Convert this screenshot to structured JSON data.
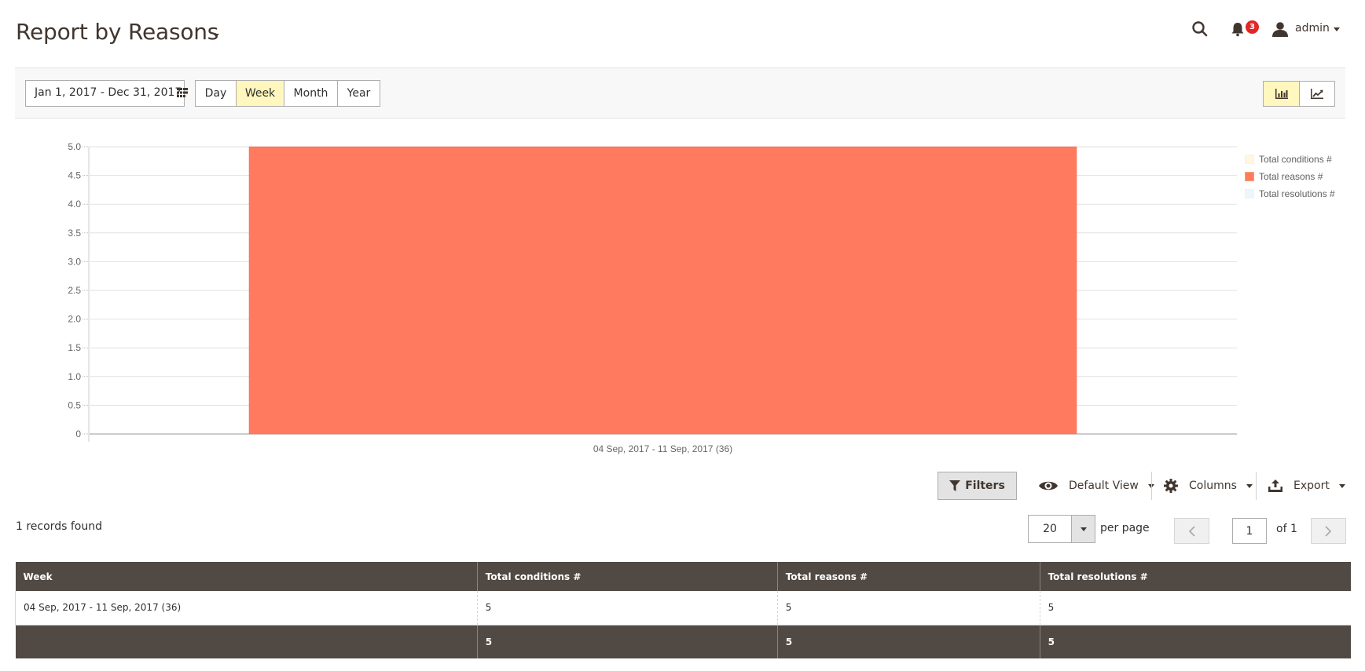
{
  "header": {
    "title": "Report by Reasons",
    "notifications_count": "3",
    "user_name": "admin"
  },
  "toolbar": {
    "date_range": "Jan 1, 2017 - Dec 31, 2017",
    "periods": [
      {
        "label": "Day",
        "active": false
      },
      {
        "label": "Week",
        "active": true
      },
      {
        "label": "Month",
        "active": false
      },
      {
        "label": "Year",
        "active": false
      }
    ],
    "chart_types": [
      {
        "name": "bar-chart",
        "active": true
      },
      {
        "name": "line-chart",
        "active": false
      }
    ]
  },
  "chart_data": {
    "type": "bar",
    "title": "",
    "xlabel": "",
    "ylabel": "",
    "categories": [
      "04 Sep, 2017 - 11 Sep, 2017 (36)"
    ],
    "series": [
      {
        "name": "Total conditions #",
        "values": [
          0
        ],
        "color": "#fff7e0"
      },
      {
        "name": "Total reasons #",
        "values": [
          5
        ],
        "color": "#ff7a5f"
      },
      {
        "name": "Total resolutions #",
        "values": [
          0
        ],
        "color": "#eaf7fb"
      }
    ],
    "ylim": [
      0,
      5
    ],
    "yticks": [
      "0",
      "0.5",
      "1.0",
      "1.5",
      "2.0",
      "2.5",
      "3.0",
      "3.5",
      "4.0",
      "4.5",
      "5.0"
    ],
    "grid": true,
    "legend": "top-right"
  },
  "grid_actions": {
    "filters": "Filters",
    "view": "Default View",
    "columns": "Columns",
    "export": "Export"
  },
  "pager": {
    "records_found": "1 records found",
    "per_page_value": "20",
    "per_page_label": "per page",
    "current_page": "1",
    "of_pages": "of 1"
  },
  "table": {
    "columns": [
      "Week",
      "Total conditions #",
      "Total reasons #",
      "Total resolutions #"
    ],
    "rows": [
      [
        "04 Sep, 2017 - 11 Sep, 2017 (36)",
        "5",
        "5",
        "5"
      ]
    ],
    "totals": [
      "",
      "5",
      "5",
      "5"
    ]
  }
}
